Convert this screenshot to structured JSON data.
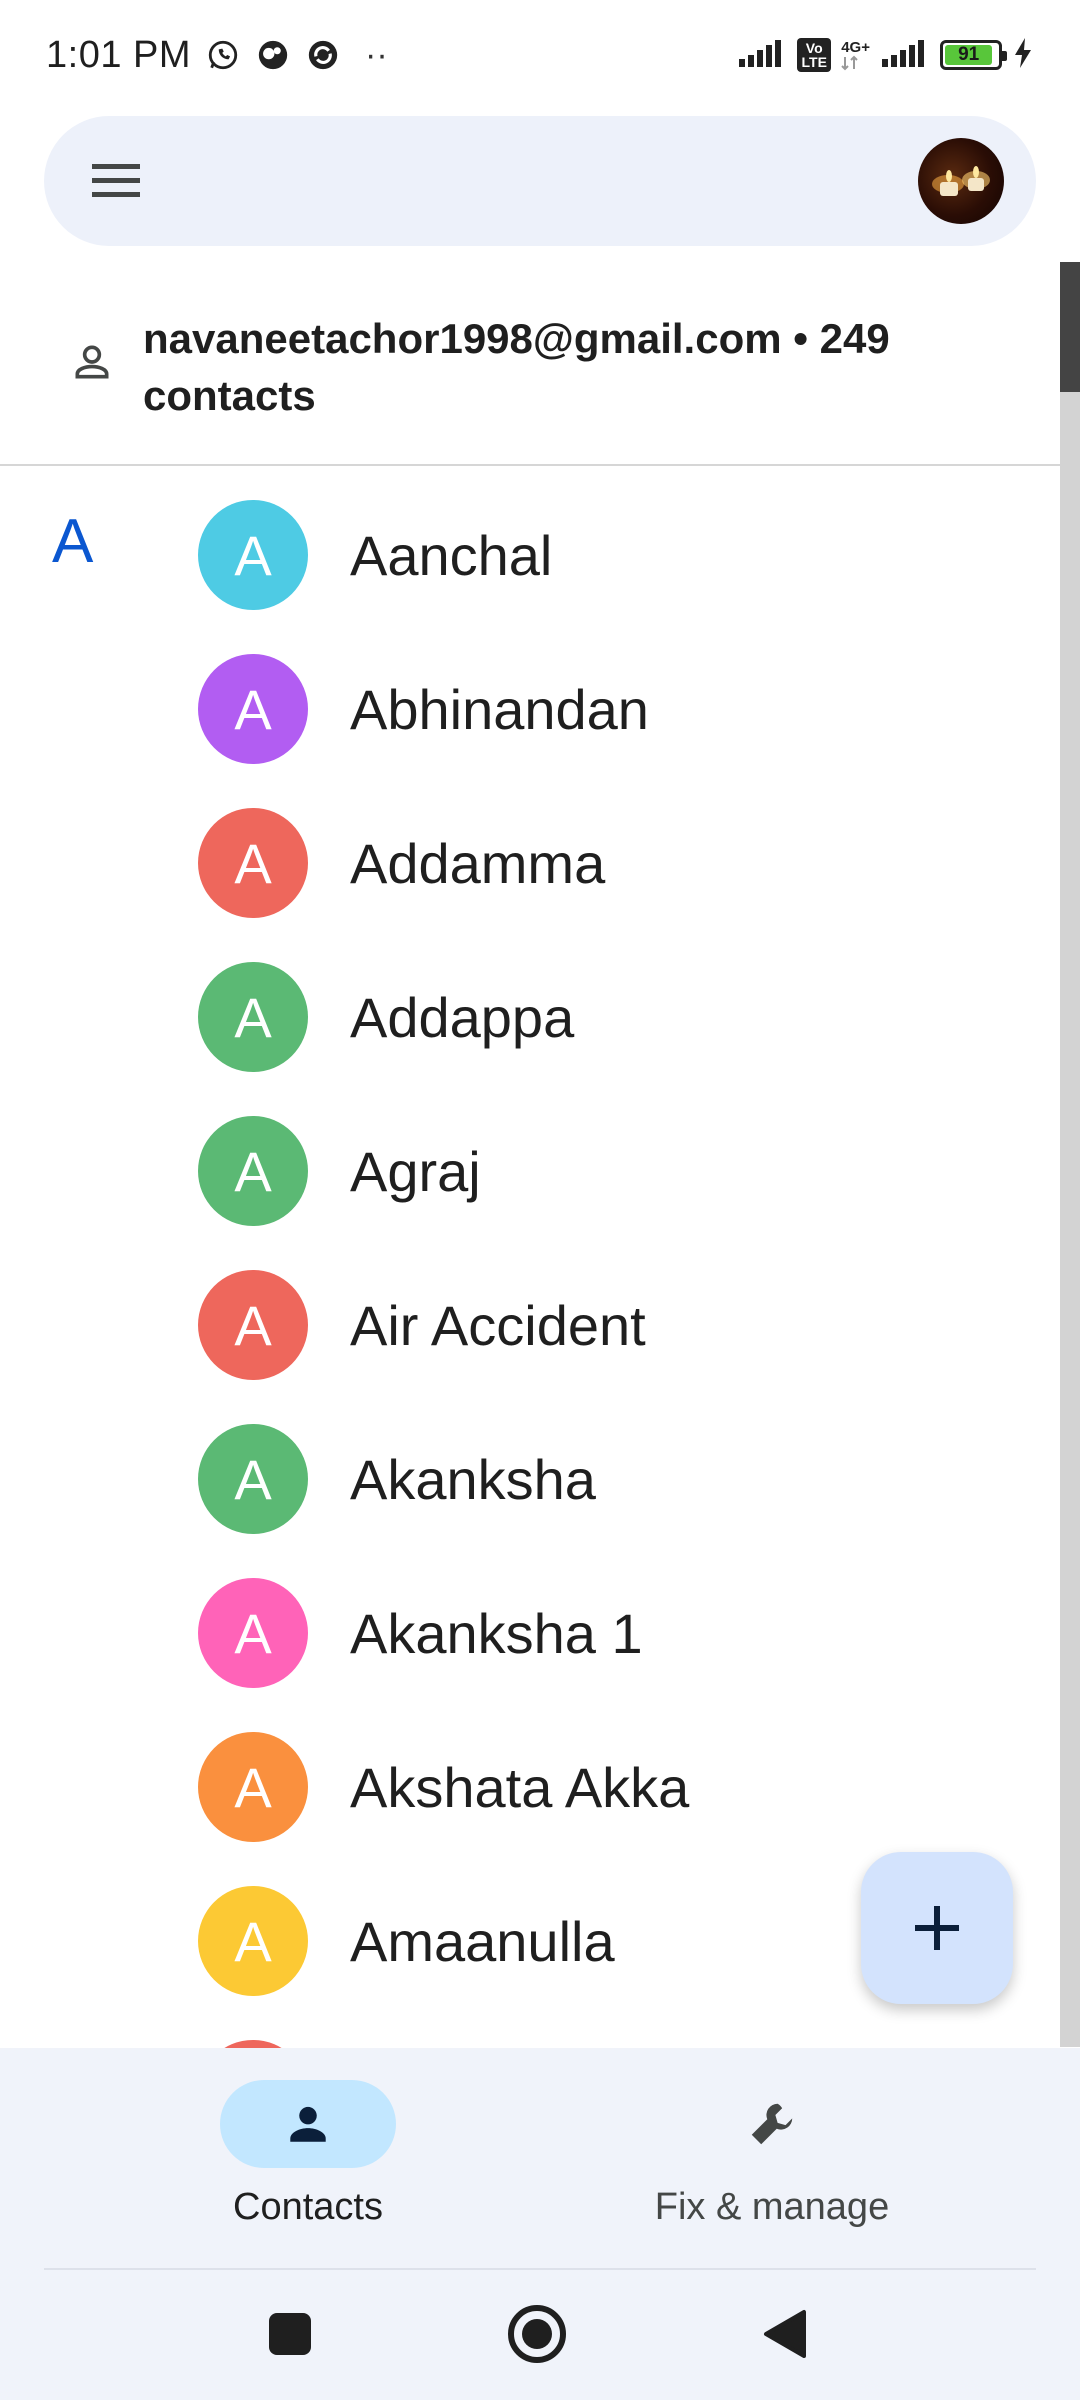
{
  "status_bar": {
    "time": "1:01 PM",
    "battery_level": "91",
    "network_label": "4G+",
    "volte_label": "Vo LTE"
  },
  "search_bar": {
    "menu_icon": "hamburger-menu-icon",
    "profile_avatar": "account-photo"
  },
  "account": {
    "line": "navaneetachor1998@gmail.com • 249 contacts"
  },
  "contacts": {
    "section_letter": "A",
    "items": [
      {
        "initial": "A",
        "name": "Aanchal",
        "color": "#4ecbe4"
      },
      {
        "initial": "A",
        "name": "Abhinandan",
        "color": "#b25df2"
      },
      {
        "initial": "A",
        "name": "Addamma",
        "color": "#ee675c"
      },
      {
        "initial": "A",
        "name": "Addappa",
        "color": "#5bb974"
      },
      {
        "initial": "A",
        "name": "Agraj",
        "color": "#5bb974"
      },
      {
        "initial": "A",
        "name": "Air Accident",
        "color": "#ee675c"
      },
      {
        "initial": "A",
        "name": "Akanksha",
        "color": "#5bb974"
      },
      {
        "initial": "A",
        "name": "Akanksha 1",
        "color": "#ff63b8"
      },
      {
        "initial": "A",
        "name": "Akshata Akka",
        "color": "#fa903e"
      },
      {
        "initial": "A",
        "name": "Amaanulla",
        "color": "#fcc934"
      },
      {
        "initial": "",
        "name": "",
        "color": "#ee675c"
      }
    ]
  },
  "fab": {
    "icon": "plus-icon"
  },
  "bottom_nav": {
    "contacts_label": "Contacts",
    "fix_manage_label": "Fix & manage"
  },
  "colors": {
    "accent": "#0b57d0",
    "nav_active_pill": "#c2e7ff",
    "fab_bg": "#d3e3fd"
  }
}
